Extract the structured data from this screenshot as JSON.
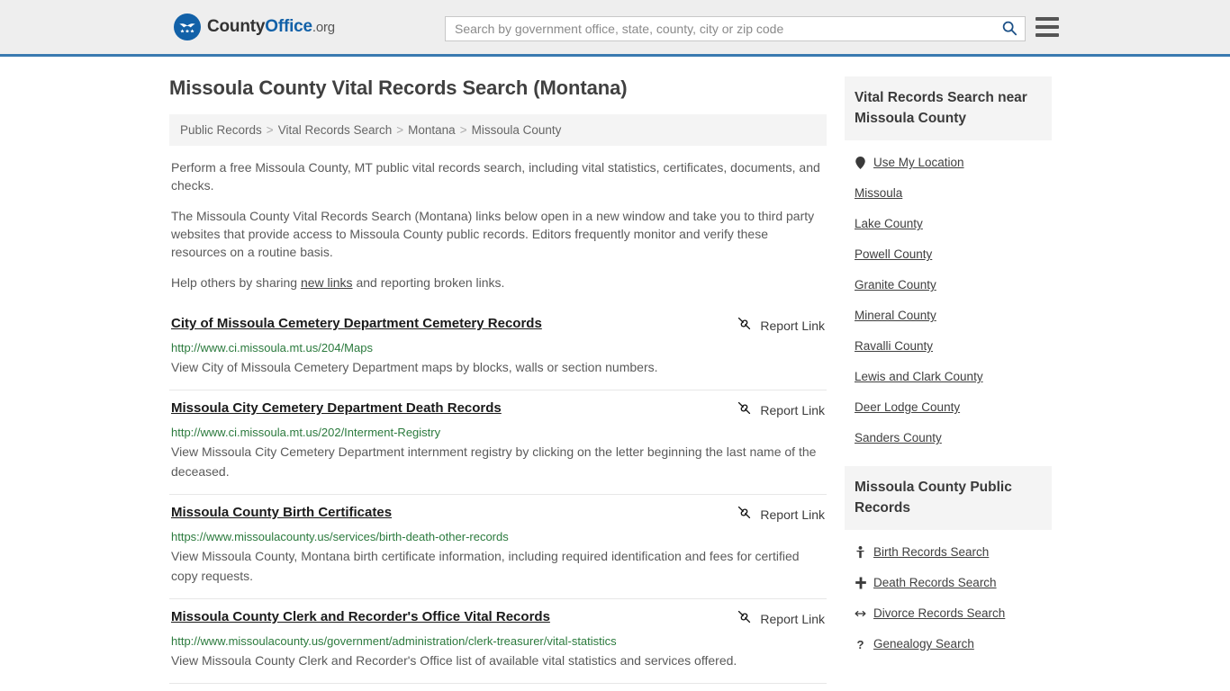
{
  "header": {
    "logo": {
      "text_1": "County",
      "text_2": "Office",
      "text_3": ".org",
      "icon": "eagle-stars-logo"
    },
    "search": {
      "placeholder": "Search by government office, state, county, city or zip code",
      "value": "",
      "icon": "search-icon"
    },
    "menu_icon": "hamburger-menu-icon",
    "accent_color": "#1261a8",
    "border_color": "#3a7ab0"
  },
  "main": {
    "title": "Missoula County Vital Records Search (Montana)",
    "breadcrumb": [
      "Public Records",
      "Vital Records Search",
      "Montana",
      "Missoula County"
    ],
    "breadcrumb_separator": ">",
    "intro": [
      "Perform a free Missoula County, MT public vital records search, including vital statistics, certificates, documents, and checks.",
      "The Missoula County Vital Records Search (Montana) links below open in a new window and take you to third party websites that provide access to Missoula County public records. Editors frequently monitor and verify these resources on a routine basis."
    ],
    "help_prefix": "Help others by sharing ",
    "help_link": "new links",
    "help_suffix": " and reporting broken links.",
    "report_label": "Report Link",
    "report_icon": "broken-link-icon",
    "results": [
      {
        "title": "City of Missoula Cemetery Department Cemetery Records",
        "url": "http://www.ci.missoula.mt.us/204/Maps",
        "description": "View City of Missoula Cemetery Department maps by blocks, walls or section numbers."
      },
      {
        "title": "Missoula City Cemetery Department Death Records",
        "url": "http://www.ci.missoula.mt.us/202/Interment-Registry",
        "description": "View Missoula City Cemetery Department internment registry by clicking on the letter beginning the last name of the deceased."
      },
      {
        "title": "Missoula County Birth Certificates",
        "url": "https://www.missoulacounty.us/services/birth-death-other-records",
        "description": "View Missoula County, Montana birth certificate information, including required identification and fees for certified copy requests."
      },
      {
        "title": "Missoula County Clerk and Recorder's Office Vital Records",
        "url": "http://www.missoulacounty.us/government/administration/clerk-treasurer/vital-statistics",
        "description": "View Missoula County Clerk and Recorder's Office list of available vital statistics and services offered."
      }
    ]
  },
  "sidebar": {
    "nearby": {
      "heading": "Vital Records Search near Missoula County",
      "items": [
        {
          "label": "Use My Location",
          "icon": "map-pin-icon"
        },
        {
          "label": "Missoula",
          "icon": ""
        },
        {
          "label": "Lake County",
          "icon": ""
        },
        {
          "label": "Powell County",
          "icon": ""
        },
        {
          "label": "Granite County",
          "icon": ""
        },
        {
          "label": "Mineral County",
          "icon": ""
        },
        {
          "label": "Ravalli County",
          "icon": ""
        },
        {
          "label": "Lewis and Clark County",
          "icon": ""
        },
        {
          "label": "Deer Lodge County",
          "icon": ""
        },
        {
          "label": "Sanders County",
          "icon": ""
        }
      ]
    },
    "public_records": {
      "heading": "Missoula County Public Records",
      "items": [
        {
          "label": "Birth Records Search",
          "icon": "baby-icon"
        },
        {
          "label": "Death Records Search",
          "icon": "cross-icon"
        },
        {
          "label": "Divorce Records Search",
          "icon": "left-right-arrow-icon"
        },
        {
          "label": "Genealogy Search",
          "icon": "question-mark-icon"
        }
      ]
    }
  }
}
